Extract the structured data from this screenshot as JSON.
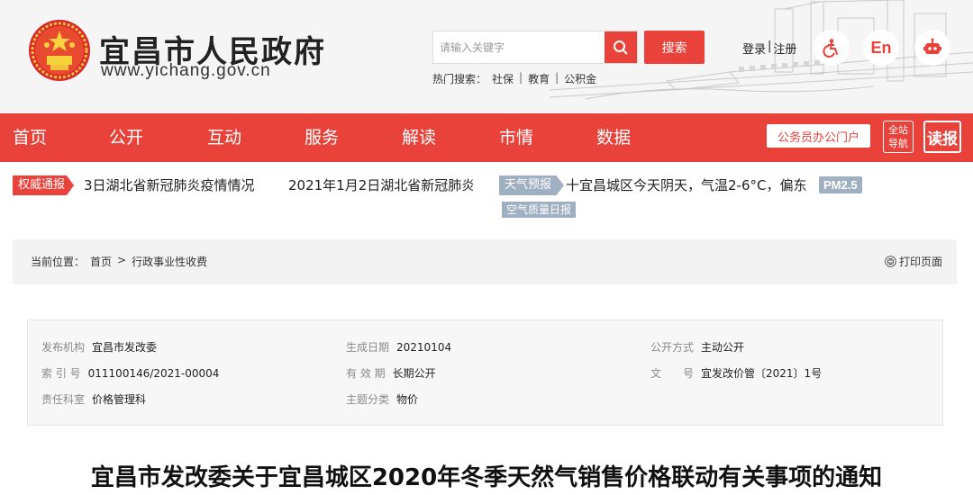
{
  "header": {
    "site_title": "宜昌市人民政府",
    "site_url": "www.yichang.gov.cn",
    "search_placeholder": "请输入关键字",
    "search_button": "搜索",
    "hot_search_label": "热门搜索：",
    "hot_search_items": [
      "社保",
      "教育",
      "公积金"
    ],
    "hot_search_sep": "|",
    "login_label": "登录",
    "login_sep": "|",
    "register_label": "注册",
    "en_label": "En",
    "icons": [
      "emblem-icon",
      "search-icon",
      "accessibility-icon",
      "language-icon",
      "robot-icon"
    ],
    "accent_color": "#e8423b"
  },
  "nav": {
    "items": [
      "首页",
      "公开",
      "互动",
      "服务",
      "解读",
      "市情",
      "数据"
    ],
    "portal_button": "公务员办公门户",
    "guide_line1": "全站",
    "guide_line2": "导航",
    "read_button": "读报"
  },
  "ticker": {
    "badge": "权威通报",
    "news_1": "3日湖北省新冠肺炎疫情情况",
    "news_2": "2021年1月2日湖北省新冠肺炎",
    "weather_badge": "天气预报",
    "weather_text": "十宜昌城区今天阴天，气温2-6°C，偏东",
    "pm_label": "PM2.5",
    "air_quality": "空气质量日报"
  },
  "breadcrumb": {
    "prefix": "当前位置：",
    "home": "首页",
    "sep": ">",
    "current": "行政事业性收费",
    "print": "打印页面"
  },
  "meta": {
    "publisher_label": "发布机构",
    "publisher": "宜昌市发改委",
    "created_label": "生成日期",
    "created": "20210104",
    "disclosure_label": "公开方式",
    "disclosure": "主动公开",
    "index_label": "索 引 号",
    "index": "011100146/2021-00004",
    "validity_label": "有 效 期",
    "validity": "长期公开",
    "docno_label": "文　　号",
    "docno": "宜发改价管〔2021〕1号",
    "dept_label": "责任科室",
    "dept": "价格管理科",
    "topic_label": "主题分类",
    "topic": "物价"
  },
  "document": {
    "title": "宜昌市发改委关于宜昌城区2020年冬季天然气销售价格联动有关事项的通知"
  }
}
